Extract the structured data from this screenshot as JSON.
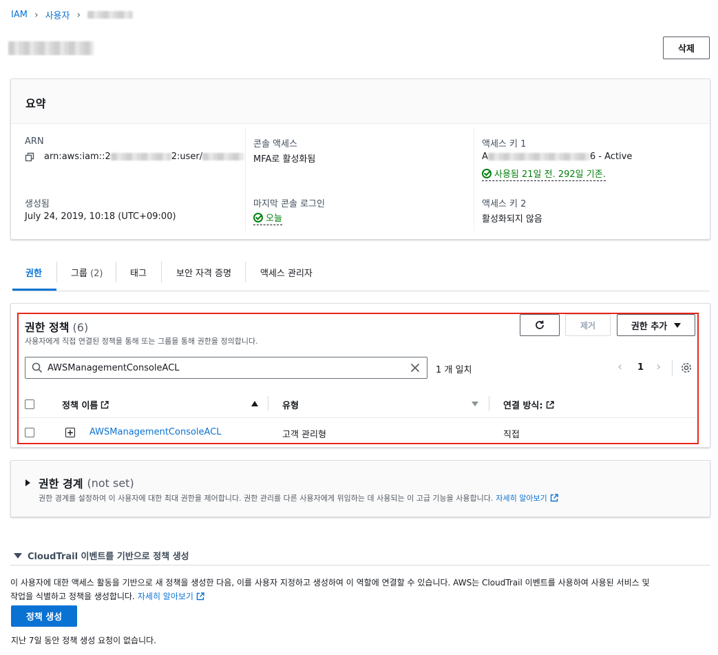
{
  "breadcrumb": {
    "root": "IAM",
    "section": "사용자"
  },
  "header": {
    "delete_label": "삭제"
  },
  "summary": {
    "title": "요약",
    "arn_label": "ARN",
    "arn_prefix": "arn:aws:iam::2",
    "arn_mid": "2:user/",
    "created_label": "생성됨",
    "created_value": "July 24, 2019, 10:18 (UTC+09:00)",
    "console_access_label": "콘솔 액세스",
    "console_access_value": "MFA로 활성화됨",
    "last_login_label": "마지막 콘솔 로그인",
    "last_login_value": "오늘",
    "access_key1_label": "액세스 키 1",
    "access_key1_prefix": "A",
    "access_key1_suffix": "6 - Active",
    "access_key1_status": "사용됨 21일 전. 292일 기존.",
    "access_key2_label": "액세스 키 2",
    "access_key2_value": "활성화되지 않음"
  },
  "tabs": [
    {
      "label": "권한",
      "active": true
    },
    {
      "label": "그룹",
      "count": "(2)"
    },
    {
      "label": "태그"
    },
    {
      "label": "보안 자격 증명"
    },
    {
      "label": "액세스 관리자"
    }
  ],
  "permissions": {
    "title": "권한 정책",
    "count": "(6)",
    "description": "사용자에게 직접 연결된 정책을 통해 또는 그룹을 통해 권한을 정의합니다.",
    "remove_label": "제거",
    "add_label": "권한 추가",
    "search_value": "AWSManagementConsoleACL",
    "match_text": "1 개 일치",
    "page_number": "1",
    "columns": {
      "name": "정책 이름",
      "type": "유형",
      "attach": "연결 방식:"
    },
    "rows": [
      {
        "name": "AWSManagementConsoleACL",
        "type": "고객 관리형",
        "attach": "직접"
      }
    ]
  },
  "boundary": {
    "title": "권한 경계",
    "status": "(not set)",
    "description": "권한 경계를 설정하여 이 사용자에 대한 최대 권한을 제어합니다. 권한 관리를 다른 사용자에게 위임하는 데 사용되는 이 고급 기능을 사용합니다.",
    "learn_more": "자세히 알아보기"
  },
  "cloudtrail": {
    "title": "CloudTrail 이벤트를 기반으로 정책 생성",
    "description_line1": "이 사용자에 대한 액세스 활동을 기반으로 새 정책을 생성한 다음, 이를 사용자 지정하고 생성하여 이 역할에 연결할 수 있습니다. AWS는 CloudTrail 이벤트를 사용하여 사용된 서비스 및",
    "description_line2": "작업을 식별하고 정책을 생성합니다.",
    "learn_more": "자세히 알아보기",
    "generate_label": "정책 생성",
    "no_requests": "지난 7일 동안 정책 생성 요청이 없습니다."
  },
  "colors": {
    "link": "#0972d3",
    "success": "#037f0c",
    "highlight": "#e8251b",
    "primary_button": "#0972d3"
  }
}
